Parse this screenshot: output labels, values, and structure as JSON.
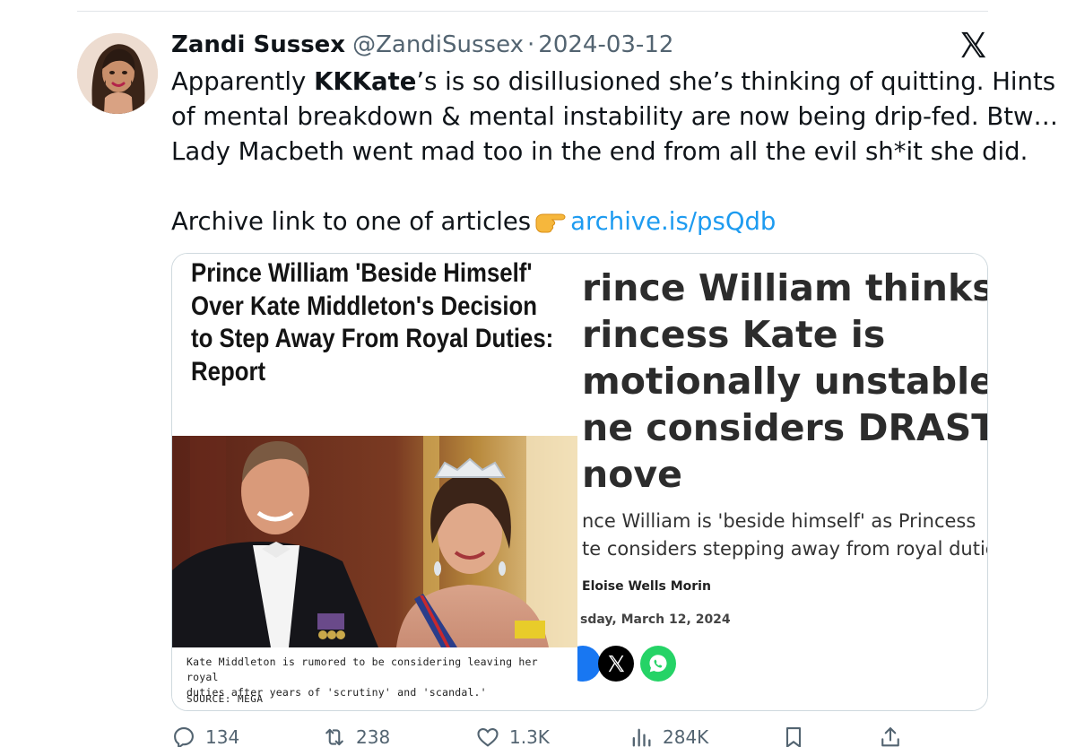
{
  "tweet": {
    "author_name": "Zandi Sussex",
    "handle": "@ZandiSussex",
    "separator": "·",
    "date": "2024-03-12",
    "text_line1_pre": "Apparently ",
    "text_line1_bold": "KKKate",
    "text_line1_post": "’s is so disillusioned she’s thinking of quitting. Hints",
    "text_line2": "of mental breakdown & mental instability are now being drip-fed. Btw…",
    "text_line3": "Lady Macbeth went mad too in the end from all the evil sh*it she did.",
    "archive_text": "Archive link to one of articles",
    "archive_link": "archive.is/psQdb"
  },
  "media": {
    "left_article": {
      "headline": [
        "Prince William 'Beside Himself'",
        "Over Kate Middleton's Decision",
        "to Step Away From Royal Duties:",
        "Report"
      ],
      "caption_line1": "Kate Middleton is rumored to be considering leaving her royal",
      "caption_line2": "duties after years of 'scrutiny' and 'scandal.'",
      "source": "SOURCE: MEGA"
    },
    "right_article": {
      "headline": [
        "rince William thinks",
        "rincess Kate is",
        "motionally unstable' as",
        "ne considers DRASTIC",
        "nove"
      ],
      "subhead": [
        "nce William is 'beside himself' as Princess",
        "te considers stepping away from royal dutie"
      ],
      "author": "Eloise Wells Morin",
      "date": "sday, March 12, 2024"
    }
  },
  "actions": {
    "replies": "134",
    "retweets": "238",
    "likes": "1.3K",
    "views": "284K"
  },
  "icons": {
    "platform": "x-logo-icon",
    "reply": "reply-icon",
    "retweet": "retweet-icon",
    "like": "heart-icon",
    "views": "views-icon",
    "bookmark": "bookmark-icon",
    "share": "share-icon"
  },
  "colors": {
    "link": "#1d9bf0",
    "secondary_text": "#536471",
    "whatsapp": "#25d366"
  }
}
